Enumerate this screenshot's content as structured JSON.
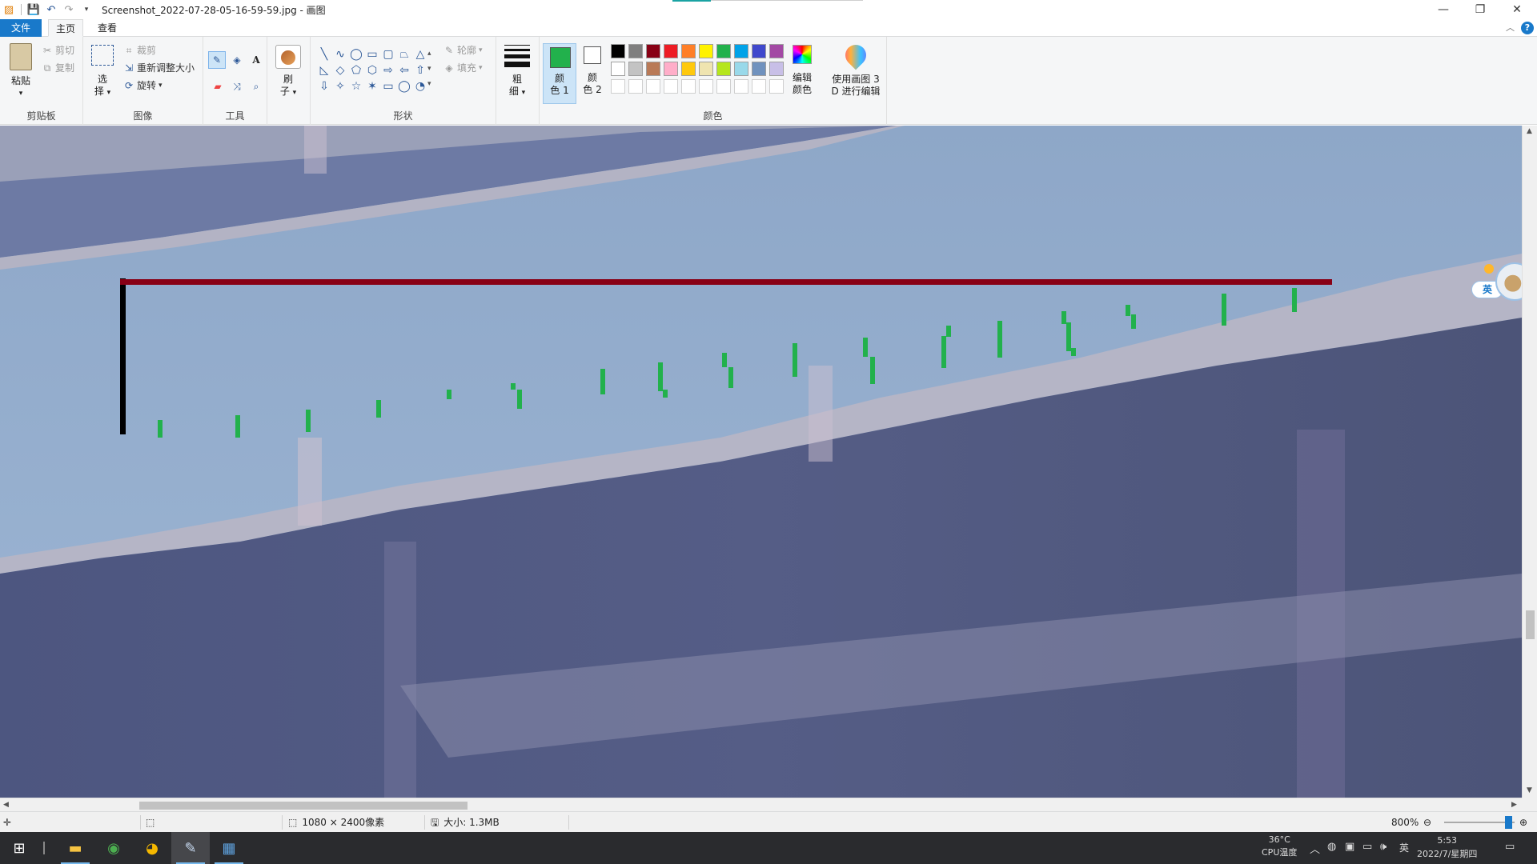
{
  "titlebar": {
    "title": "Screenshot_2022-07-28-05-16-59-59.jpg - 画图",
    "minimize_icon": "minimize-icon",
    "restore_icon": "restore-icon",
    "close_icon": "close-icon"
  },
  "tabs": {
    "file": "文件",
    "home": "主页",
    "view": "查看"
  },
  "ribbon": {
    "clipboard": {
      "paste": "粘贴",
      "cut": "剪切",
      "copy": "复制",
      "group": "剪贴板"
    },
    "image": {
      "select_1": "选",
      "select_2": "择",
      "crop": "裁剪",
      "resize": "重新调整大小",
      "rotate": "旋转",
      "group": "图像"
    },
    "tools": {
      "group": "工具"
    },
    "brushes": {
      "label_1": "刷",
      "label_2": "子"
    },
    "shapes": {
      "outline": "轮廓",
      "fill": "填充",
      "group": "形状"
    },
    "size": {
      "label_1": "粗",
      "label_2": "细"
    },
    "colors": {
      "color1_1": "颜",
      "color1_2": "色 1",
      "color2_1": "颜",
      "color2_2": "色 2",
      "edit_1": "编辑",
      "edit_2": "颜色",
      "paint3d_1": "使用画图 3",
      "paint3d_2": "D 进行编辑",
      "group": "颜色",
      "active_color": "#22b14c",
      "palette_row1": [
        "#000000",
        "#7f7f7f",
        "#880015",
        "#ed1c24",
        "#ff7f27",
        "#fff200",
        "#22b14c",
        "#00a2e8",
        "#3f48cc",
        "#a349a4"
      ],
      "palette_row2": [
        "#ffffff",
        "#c3c3c3",
        "#b97a57",
        "#ffaec9",
        "#ffc90e",
        "#efe4b0",
        "#b5e61d",
        "#99d9ea",
        "#7092be",
        "#c8bfe7"
      ]
    }
  },
  "ime": {
    "label": "英"
  },
  "statusbar": {
    "dimensions": "1080 × 2400像素",
    "size": "大小: 1.3MB",
    "zoom": "800%"
  },
  "taskbar": {
    "temp": "36°C",
    "temp_label": "CPU温度",
    "ime": "英",
    "time": "5:53",
    "date": "2022/7/星期四"
  }
}
